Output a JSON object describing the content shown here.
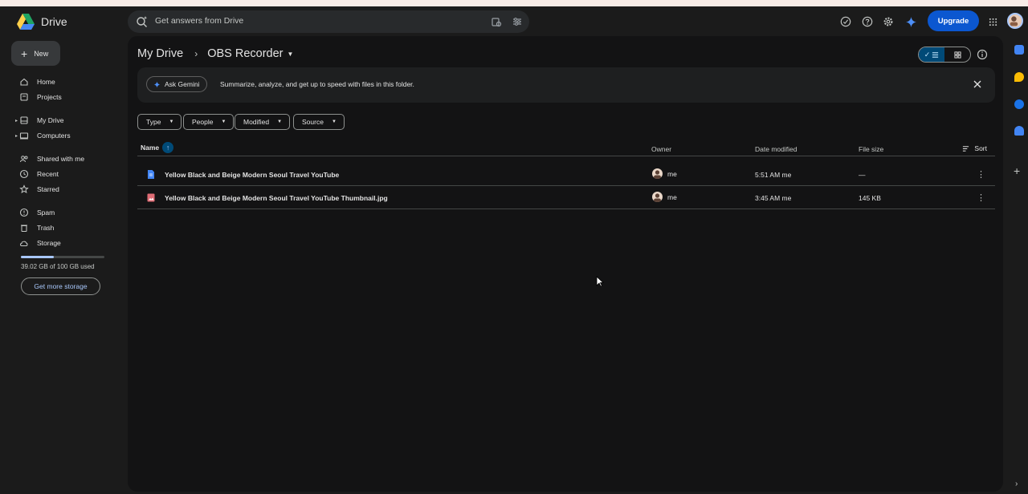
{
  "app": {
    "name": "Drive"
  },
  "search": {
    "placeholder": "Get answers from Drive"
  },
  "header": {
    "upgrade_label": "Upgrade"
  },
  "sidebar": {
    "new_label": "New",
    "items": [
      {
        "label": "Home",
        "icon": "home-icon"
      },
      {
        "label": "Projects",
        "icon": "projects-icon"
      },
      {
        "label": "My Drive",
        "icon": "drive-icon"
      },
      {
        "label": "Computers",
        "icon": "computer-icon"
      },
      {
        "label": "Shared with me",
        "icon": "people-icon"
      },
      {
        "label": "Recent",
        "icon": "clock-icon"
      },
      {
        "label": "Starred",
        "icon": "star-icon"
      },
      {
        "label": "Spam",
        "icon": "spam-icon"
      },
      {
        "label": "Trash",
        "icon": "trash-icon"
      },
      {
        "label": "Storage",
        "icon": "cloud-icon"
      }
    ],
    "storage_used_fraction": 0.39,
    "storage_text": "39.02 GB of 100 GB used",
    "get_more_storage": "Get more storage"
  },
  "breadcrumb": {
    "root": "My Drive",
    "current": "OBS Recorder"
  },
  "gemini": {
    "button_label": "Ask Gemini",
    "message": "Summarize, analyze, and get up to speed with files in this folder."
  },
  "filters": [
    "Type",
    "People",
    "Modified",
    "Source"
  ],
  "table": {
    "columns": {
      "name": "Name",
      "owner": "Owner",
      "date": "Date modified",
      "size": "File size",
      "sort": "Sort"
    },
    "rows": [
      {
        "name": "Yellow Black and Beige Modern Seoul Travel YouTube",
        "type": "doc",
        "owner": "me",
        "date": "5:51 AM me",
        "size": "—"
      },
      {
        "name": "Yellow Black and Beige Modern Seoul Travel YouTube Thumbnail.jpg",
        "type": "image",
        "owner": "me",
        "date": "3:45 AM me",
        "size": "145 KB"
      }
    ]
  },
  "colors": {
    "accent": "#0b57d0",
    "panel": "#131314",
    "background": "#1b1b1b"
  }
}
